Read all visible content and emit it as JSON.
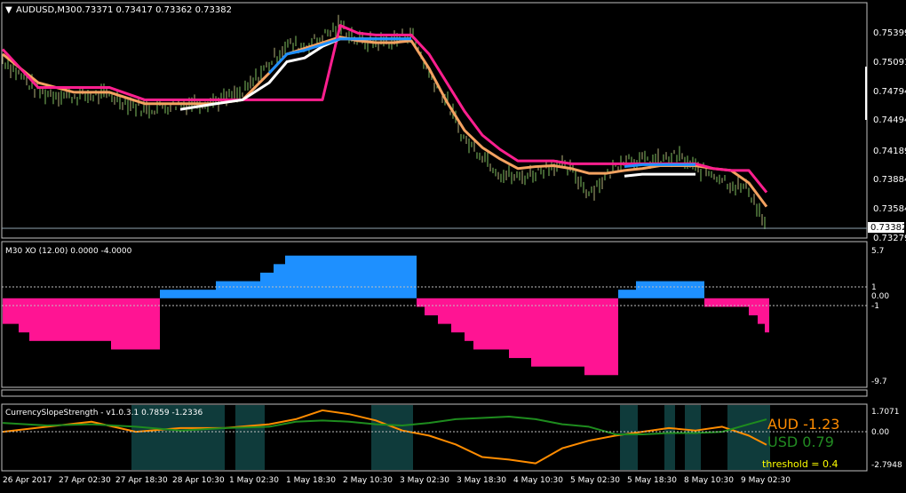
{
  "window": {
    "symbol_title": "AUDUSD,M30",
    "ohlc": "0.73371 0.73417 0.73362 0.73382"
  },
  "price_axis": {
    "ticks": [
      "0.75399",
      "0.75091",
      "0.74794",
      "0.74494",
      "0.74189",
      "0.73884",
      "0.73584"
    ],
    "last_price_label": "0.73382",
    "bottom_label": "0.73279"
  },
  "xo_panel": {
    "title": "M30 XO (12.00) 0.0000 -4.0000",
    "ticks": [
      "5.7",
      "1",
      "0.00",
      "-1",
      "-9.7"
    ]
  },
  "css_panel": {
    "title": "CurrencySlopeStrength - v1.0.3.1 0.7859 -1.2336",
    "ticks": [
      "1.7071",
      "0.00",
      "-2.7948"
    ],
    "aud_label": "AUD",
    "aud_value": "-1.23",
    "usd_label": "USD",
    "usd_value": " 0.79",
    "threshold_text": "threshold = 0.4"
  },
  "time_axis": {
    "labels": [
      "26 Apr 2017",
      "27 Apr 02:30",
      "27 Apr 18:30",
      "28 Apr 10:30",
      "1 May 02:30",
      "1 May 18:30",
      "2 May 10:30",
      "3 May 02:30",
      "3 May 18:30",
      "4 May 10:30",
      "5 May 02:30",
      "5 May 18:30",
      "8 May 10:30",
      "9 May 02:30"
    ]
  },
  "colors": {
    "background": "#000000",
    "grid": "#c0c0c0",
    "price_bars": "#7fbf5f",
    "price_bars_light": "#b5b07a",
    "pink_line": "#ff1f8f",
    "orange_line": "#f4a261",
    "white_line": "#ffffff",
    "blue_line": "#1e90ff",
    "xo_positive": "#1e90ff",
    "xo_negative": "#ff1493",
    "css_zone": "#0f3b3b",
    "aud_line": "#ff8c00",
    "usd_line": "#1e8c1e",
    "aud_text": "#ff8c00",
    "usd_text": "#228b22",
    "threshold_text": "#ffff00"
  },
  "chart_data": [
    {
      "type": "line",
      "title": "AUDUSD,M30",
      "ylim": [
        0.7328,
        0.7573
      ],
      "x": [
        0,
        40,
        80,
        120,
        160,
        200,
        240,
        270,
        300,
        320,
        340,
        360,
        380,
        400,
        420,
        440,
        460,
        480,
        500,
        520,
        540,
        560,
        580,
        600,
        620,
        640,
        660,
        680,
        700,
        720,
        740,
        760,
        780,
        800,
        820,
        840,
        860
      ],
      "series": [
        {
          "values": [
            0.7515,
            0.748,
            0.7476,
            0.7477,
            0.7462,
            0.7468,
            0.7471,
            0.7478,
            0.751,
            0.753,
            0.7528,
            0.7538,
            0.755,
            0.7534,
            0.7532,
            0.7534,
            0.7542,
            0.75,
            0.747,
            0.743,
            0.7415,
            0.7395,
            0.739,
            0.7396,
            0.7405,
            0.7398,
            0.7375,
            0.7392,
            0.7412,
            0.7408,
            0.7408,
            0.7413,
            0.74,
            0.7395,
            0.7384,
            0.7378,
            0.7338
          ]
        },
        {
          "values": [
            0.752,
            0.749,
            0.748,
            0.748,
            0.7468,
            0.7468,
            0.7468,
            0.7472,
            0.75,
            0.752,
            0.7526,
            0.7532,
            0.7538,
            0.7534,
            0.7532,
            0.7532,
            0.7534,
            0.7505,
            0.747,
            0.744,
            0.7422,
            0.741,
            0.74,
            0.7402,
            0.7403,
            0.74,
            0.7395,
            0.7395,
            0.7398,
            0.74,
            0.7403,
            0.7403,
            0.7403,
            0.74,
            0.7398,
            0.7385,
            0.736
          ]
        },
        {
          "values": [
            0.7525,
            0.7485,
            0.7485,
            0.7485,
            0.7472,
            0.7472,
            0.7472,
            0.7472,
            0.7472,
            0.7472,
            0.7472,
            0.7472,
            0.755,
            0.7542,
            0.754,
            0.754,
            0.754,
            0.752,
            0.749,
            0.746,
            0.7435,
            0.742,
            0.7408,
            0.7408,
            0.7408,
            0.7405,
            0.7405,
            0.7405,
            0.7405,
            0.7405,
            0.7405,
            0.7405,
            0.7405,
            0.74,
            0.7398,
            0.7398,
            0.7375
          ]
        },
        {
          "values": [
            null,
            null,
            null,
            null,
            null,
            0.7462,
            0.7468,
            0.7472,
            0.749,
            0.7512,
            0.7516,
            0.7528,
            0.7536,
            0.7536,
            0.7536,
            0.7536,
            0.7536,
            null,
            null,
            null,
            null,
            null,
            null,
            null,
            null,
            null,
            null,
            null,
            0.7392,
            0.7394,
            0.7394,
            0.7394,
            0.7394,
            null,
            null,
            null,
            null
          ]
        },
        {
          "values": [
            null,
            null,
            null,
            null,
            null,
            null,
            null,
            null,
            0.75,
            0.752,
            0.7524,
            0.753,
            0.7536,
            0.7536,
            0.7536,
            0.7536,
            0.7536,
            null,
            null,
            null,
            null,
            null,
            null,
            null,
            null,
            null,
            null,
            null,
            0.7402,
            0.7404,
            0.7404,
            0.7404,
            0.7404,
            null,
            null,
            null,
            null
          ]
        }
      ]
    },
    {
      "type": "bar",
      "title": "M30 XO (12.00) 0.0000 -4.0000",
      "ylim": [
        -9.7,
        5.7
      ],
      "bars": [
        [
          0,
          18,
          -3
        ],
        [
          18,
          30,
          -4
        ],
        [
          30,
          122,
          -5
        ],
        [
          122,
          177,
          -6
        ],
        [
          177,
          240,
          1
        ],
        [
          240,
          290,
          2
        ],
        [
          290,
          305,
          3
        ],
        [
          305,
          318,
          4
        ],
        [
          318,
          466,
          5
        ],
        [
          466,
          475,
          -1
        ],
        [
          475,
          490,
          -2
        ],
        [
          490,
          505,
          -3
        ],
        [
          505,
          520,
          -4
        ],
        [
          520,
          530,
          -5
        ],
        [
          530,
          570,
          -6
        ],
        [
          570,
          595,
          -7
        ],
        [
          595,
          655,
          -8
        ],
        [
          655,
          693,
          -9
        ],
        [
          693,
          713,
          1
        ],
        [
          713,
          790,
          2
        ],
        [
          790,
          840,
          -1
        ],
        [
          840,
          850,
          -2
        ],
        [
          850,
          858,
          -3
        ],
        [
          858,
          863,
          -4
        ]
      ]
    },
    {
      "type": "line",
      "title": "CurrencySlopeStrength - v1.0.3.1 0.7859 -1.2336",
      "ylim": [
        -2.7948,
        1.7071
      ],
      "x": [
        0,
        50,
        100,
        150,
        200,
        250,
        300,
        330,
        360,
        390,
        420,
        450,
        480,
        510,
        540,
        570,
        600,
        630,
        660,
        690,
        720,
        750,
        780,
        810,
        840,
        860
      ],
      "series": [
        {
          "name": "AUD",
          "values": [
            -0.2,
            0.2,
            0.6,
            -0.2,
            0.1,
            0.1,
            0.4,
            0.8,
            1.5,
            1.2,
            0.7,
            -0.1,
            -0.5,
            -1.2,
            -2.2,
            -2.4,
            -2.7,
            -1.5,
            -0.9,
            -0.5,
            -0.2,
            0.1,
            -0.1,
            0.2,
            -0.5,
            -1.23
          ]
        },
        {
          "name": "USD",
          "values": [
            0.5,
            0.3,
            0.4,
            0.2,
            -0.1,
            0.1,
            0.2,
            0.6,
            0.7,
            0.6,
            0.4,
            0.3,
            0.5,
            0.8,
            0.9,
            1.0,
            0.8,
            0.4,
            0.2,
            -0.4,
            -0.4,
            -0.3,
            -0.3,
            -0.2,
            0.4,
            0.79
          ]
        }
      ]
    }
  ]
}
